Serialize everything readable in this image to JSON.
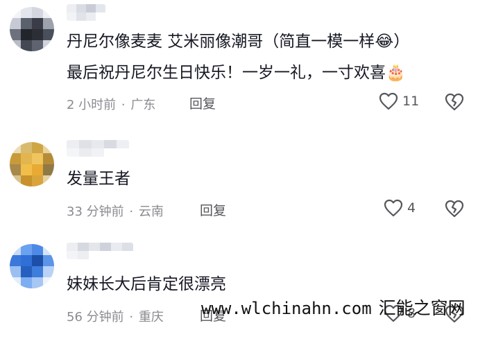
{
  "comments": [
    {
      "text_line1": "丹尼尔像麦麦 艾米丽像潮哥（简直一模一样",
      "emoji1": "😂",
      "text_line1_end": "）",
      "text_line2": "最后祝丹尼尔生日快乐！一岁一礼，一寸欢喜",
      "emoji2": "🎂",
      "time": "2 小时前",
      "location": "广东",
      "reply_label": "回复",
      "likes": "11",
      "avatar_colors": [
        "#e9ecf2",
        "#4a4f5c",
        "#2c2e36",
        "#b9bcc6"
      ]
    },
    {
      "text": "发量王者",
      "time": "33 分钟前",
      "location": "云南",
      "reply_label": "回复",
      "likes": "4",
      "avatar_colors": [
        "#d7b25a",
        "#c9912b",
        "#e5c67b",
        "#8f7a46"
      ]
    },
    {
      "text": "妹妹长大后肯定很漂亮",
      "time": "56 分钟前",
      "location": "重庆",
      "reply_label": "回复",
      "likes": "8",
      "avatar_colors": [
        "#2f6fd6",
        "#6aa2f0",
        "#1d4fa8",
        "#b9d2f7"
      ]
    }
  ],
  "separator": "·",
  "watermark": {
    "url": "www.wlchinahn.com",
    "brand": "汇能之窗网"
  },
  "colors": {
    "text": "#161823",
    "meta": "#8a8b91",
    "icon": "#55565b"
  }
}
